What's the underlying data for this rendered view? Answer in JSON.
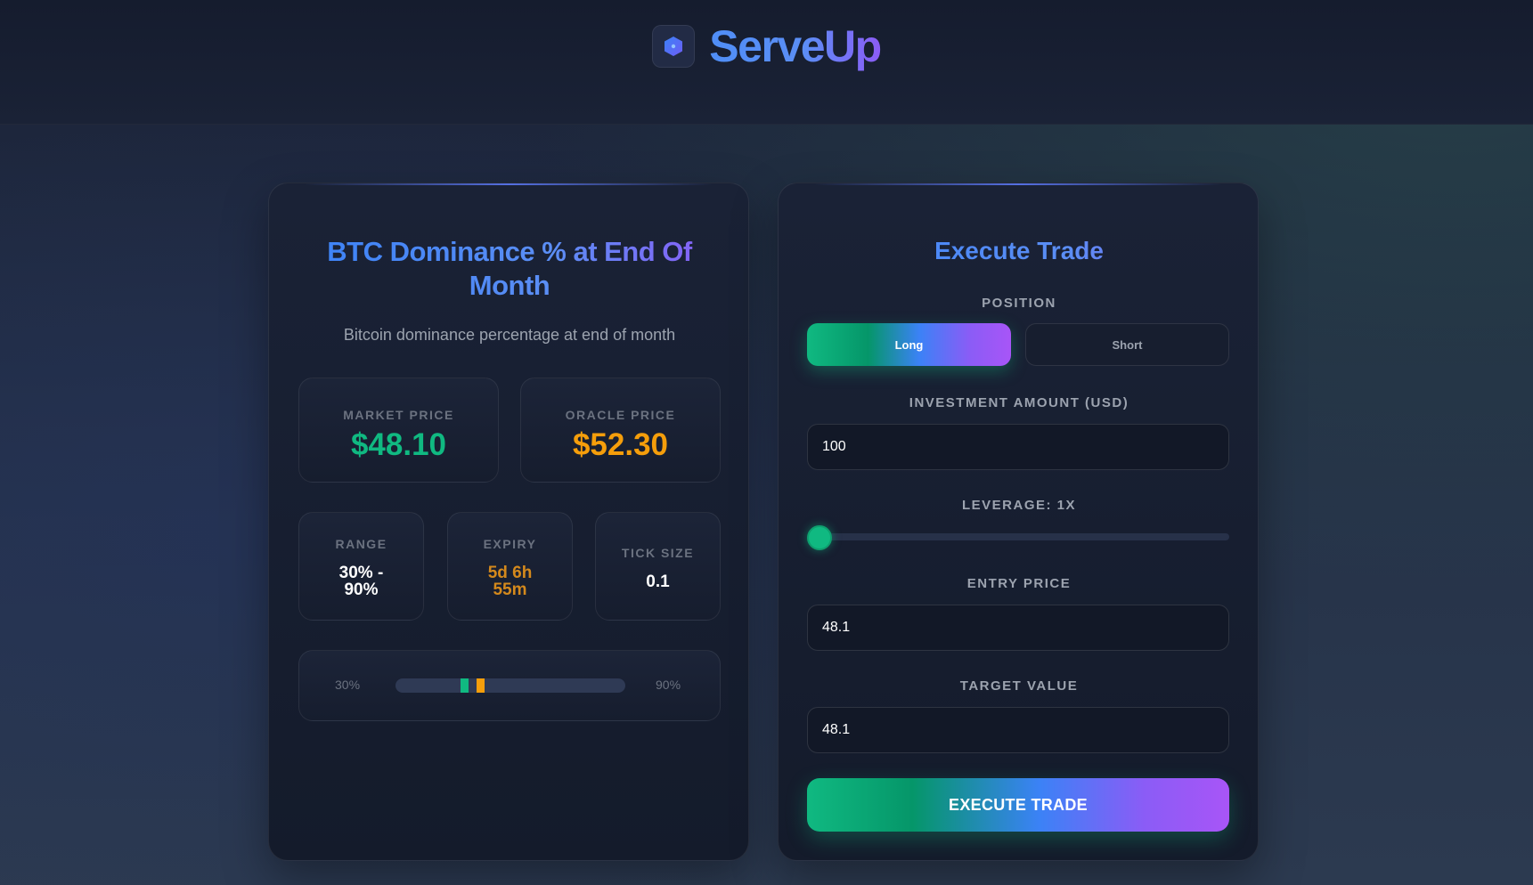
{
  "app": {
    "name": "ServeUp",
    "logo_icon": "hexagon-icon"
  },
  "market": {
    "title": "BTC Dominance % at End Of Month",
    "description": "Bitcoin dominance percentage at end of month",
    "market_price": {
      "label": "MARKET PRICE",
      "value": "$48.10",
      "color": "#10b981"
    },
    "oracle_price": {
      "label": "ORACLE PRICE",
      "value": "$52.30",
      "color": "#f59e0b"
    },
    "range": {
      "label": "RANGE",
      "value_line1": "30% -",
      "value_line2": "90%"
    },
    "expiry": {
      "label": "EXPIRY",
      "value_line1": "5d 6h",
      "value_line2": "55m",
      "color": "#f59e0b"
    },
    "tick_size": {
      "label": "TICK SIZE",
      "value": "0.1"
    },
    "range_bar": {
      "min_label": "30%",
      "max_label": "90%",
      "min": 30,
      "max": 90,
      "market_marker": 48.1,
      "oracle_marker": 52.3
    }
  },
  "trade": {
    "title": "Execute Trade",
    "position": {
      "label": "POSITION",
      "long_label": "Long",
      "short_label": "Short",
      "selected": "Long"
    },
    "investment": {
      "label": "INVESTMENT AMOUNT (USD)",
      "value": "100"
    },
    "leverage": {
      "label": "LEVERAGE: 1X",
      "value": 1,
      "min": 1,
      "max": 100
    },
    "entry_price": {
      "label": "ENTRY PRICE",
      "value": "48.1"
    },
    "target_value": {
      "label": "TARGET VALUE",
      "value": "48.1"
    },
    "execute_label": "EXECUTE TRADE"
  },
  "colors": {
    "accent_green": "#10b981",
    "accent_blue": "#3b82f6",
    "accent_purple": "#8b5cf6",
    "accent_orange": "#f59e0b"
  }
}
